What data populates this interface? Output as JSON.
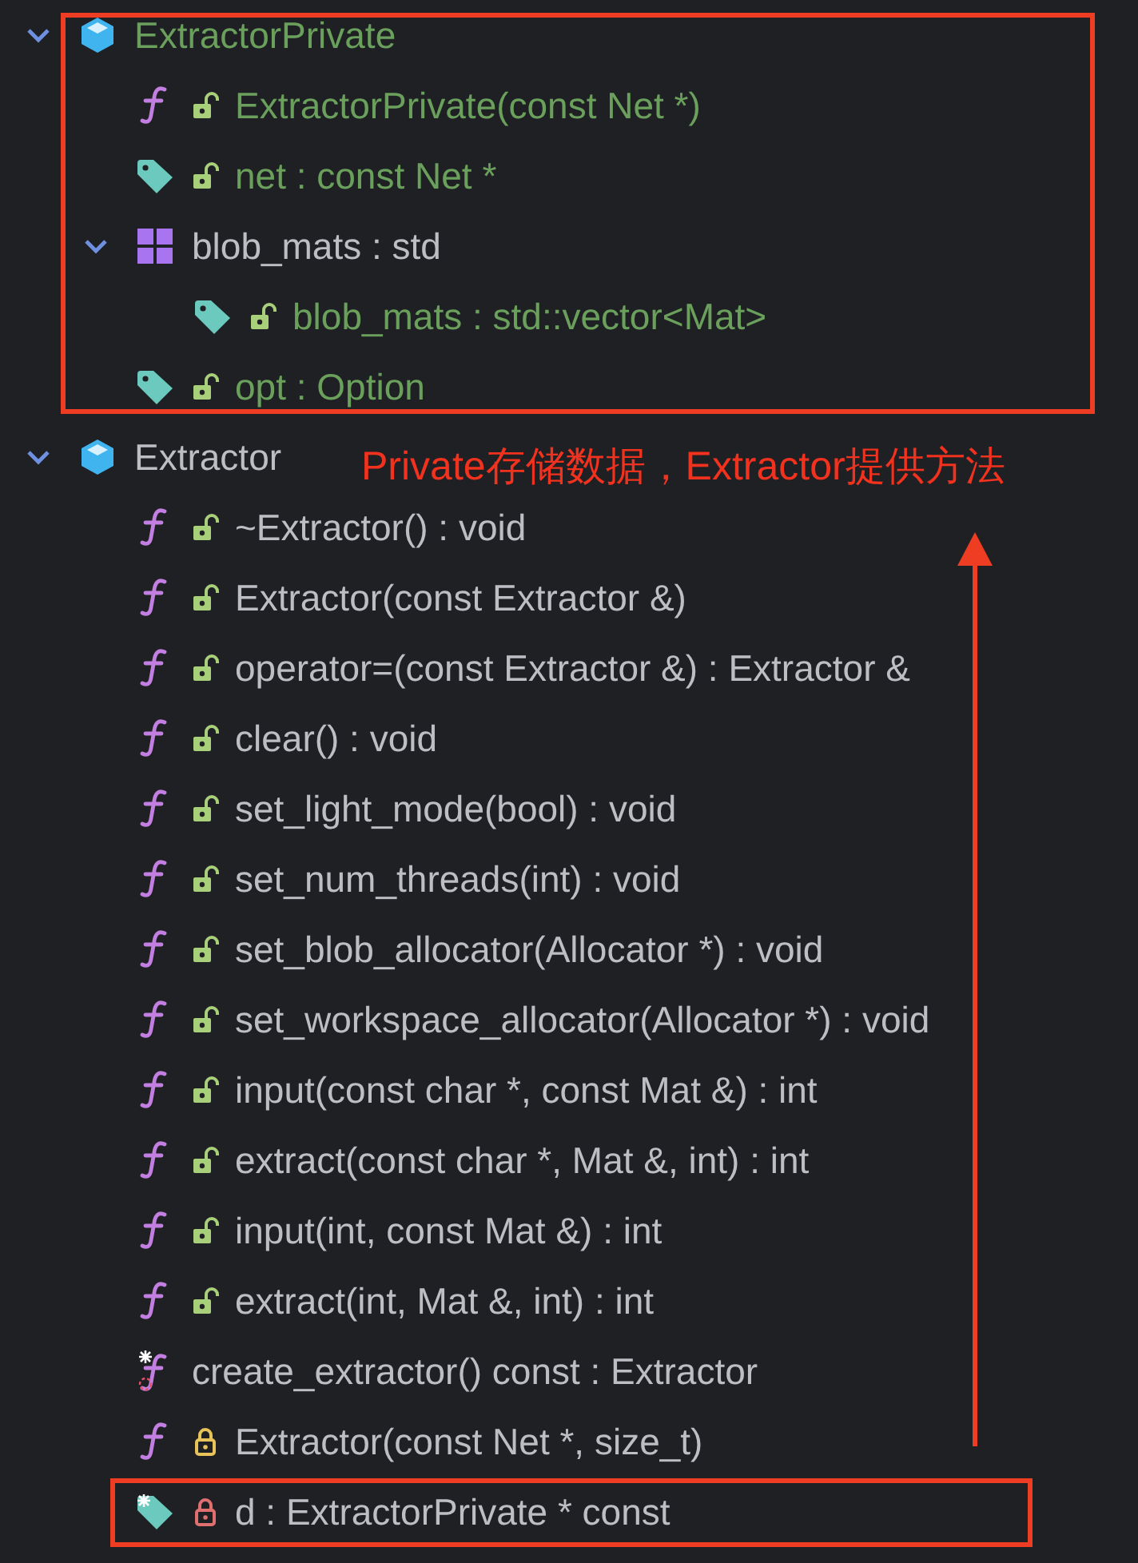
{
  "outline": [
    {
      "kind": "class",
      "label": "ExtractorPrivate",
      "highlighted": true,
      "expanded": true,
      "children": [
        {
          "kind": "function",
          "locked": false,
          "color": "#a8cf7a",
          "label": "ExtractorPrivate(const Net *)",
          "highlighted": true
        },
        {
          "kind": "field",
          "locked": false,
          "color": "#a8cf7a",
          "label": "net : const Net *",
          "highlighted": true
        },
        {
          "kind": "namespace",
          "label": "blob_mats : std",
          "highlighted": false,
          "expanded": true,
          "children": [
            {
              "kind": "field",
              "locked": false,
              "color": "#a8cf7a",
              "label": "blob_mats : std::vector<Mat>",
              "highlighted": true
            }
          ]
        },
        {
          "kind": "field",
          "locked": false,
          "color": "#a8cf7a",
          "label": "opt : Option",
          "highlighted": true
        }
      ]
    },
    {
      "kind": "class",
      "label": "Extractor",
      "highlighted": false,
      "expanded": true,
      "children": [
        {
          "kind": "function",
          "locked": false,
          "color": "#a8cf7a",
          "label": "~Extractor() : void",
          "highlighted": false
        },
        {
          "kind": "function",
          "locked": false,
          "color": "#a8cf7a",
          "label": "Extractor(const Extractor &)",
          "highlighted": false
        },
        {
          "kind": "function",
          "locked": false,
          "color": "#a8cf7a",
          "label": "operator=(const Extractor &) : Extractor &",
          "highlighted": false
        },
        {
          "kind": "function",
          "locked": false,
          "color": "#a8cf7a",
          "label": "clear() : void",
          "highlighted": false
        },
        {
          "kind": "function",
          "locked": false,
          "color": "#a8cf7a",
          "label": "set_light_mode(bool) : void",
          "highlighted": false
        },
        {
          "kind": "function",
          "locked": false,
          "color": "#a8cf7a",
          "label": "set_num_threads(int) : void",
          "highlighted": false
        },
        {
          "kind": "function",
          "locked": false,
          "color": "#a8cf7a",
          "label": "set_blob_allocator(Allocator *) : void",
          "highlighted": false
        },
        {
          "kind": "function",
          "locked": false,
          "color": "#a8cf7a",
          "label": "set_workspace_allocator(Allocator *) : void",
          "highlighted": false
        },
        {
          "kind": "function",
          "locked": false,
          "color": "#a8cf7a",
          "label": "input(const char *, const Mat &) : int",
          "highlighted": false
        },
        {
          "kind": "function",
          "locked": false,
          "color": "#a8cf7a",
          "label": "extract(const char *, Mat &, int) : int",
          "highlighted": false
        },
        {
          "kind": "function",
          "locked": false,
          "color": "#a8cf7a",
          "label": "input(int, const Mat &) : int",
          "highlighted": false
        },
        {
          "kind": "function",
          "locked": false,
          "color": "#a8cf7a",
          "label": "extract(int, Mat &, int) : int",
          "highlighted": false
        },
        {
          "kind": "static-function",
          "label": "create_extractor() const : Extractor",
          "highlighted": false
        },
        {
          "kind": "function",
          "locked": true,
          "color": "#e8c35a",
          "label": "Extractor(const Net *, size_t)",
          "highlighted": false
        },
        {
          "kind": "static-field",
          "locked": true,
          "color": "#e07070",
          "label": "d : ExtractorPrivate * const",
          "highlighted": false
        }
      ]
    }
  ],
  "annotation": {
    "note": "Private存储数据，Extractor提供方法"
  }
}
